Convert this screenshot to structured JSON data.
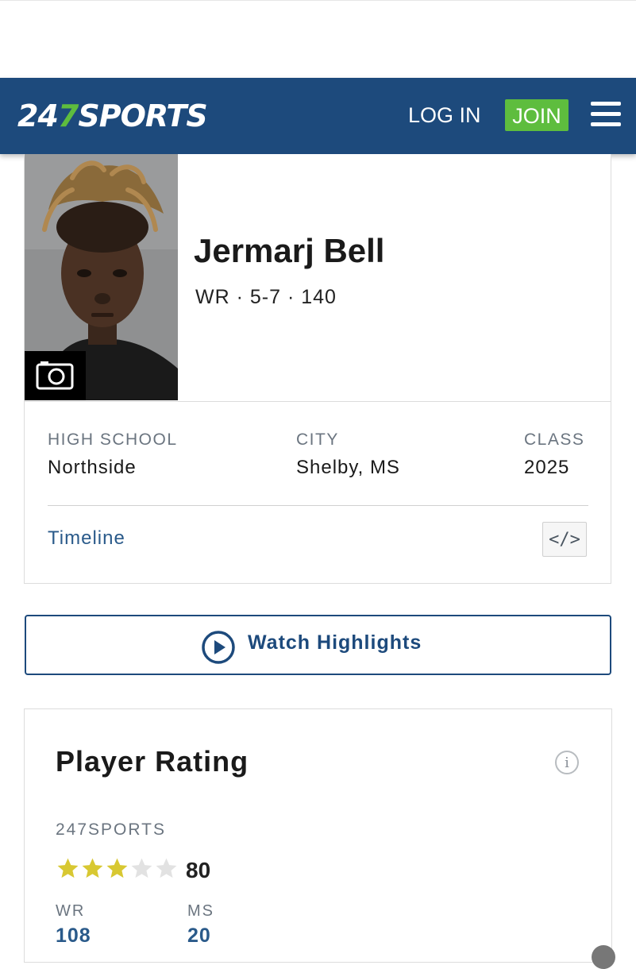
{
  "header": {
    "logo_prefix": "24",
    "logo_seven": "7",
    "logo_suffix": "SPORTS",
    "login_label": "LOG IN",
    "join_label": "JOIN",
    "menu_icon": "hamburger-menu-icon"
  },
  "player": {
    "name": "Jermarj Bell",
    "meta": "WR · 5-7 · 140",
    "photo_icon": "camera-icon"
  },
  "info": {
    "high_school_label": "HIGH SCHOOL",
    "high_school_value": "Northside",
    "city_label": "CITY",
    "city_value": "Shelby, MS",
    "class_label": "CLASS",
    "class_value": "2025",
    "timeline_label": "Timeline",
    "embed_icon": "</>"
  },
  "highlights": {
    "label": "Watch Highlights",
    "icon": "play-circle-icon"
  },
  "rating": {
    "title": "Player Rating",
    "info_icon": "i",
    "source": "247SPORTS",
    "stars_filled": 3,
    "stars_total": 5,
    "score": "80",
    "position_label": "WR",
    "position_rank": "108",
    "state_label": "MS",
    "state_rank": "20"
  },
  "colors": {
    "brand_blue": "#1d4a7c",
    "brand_green": "#5ebd3e",
    "star_gold": "#d8c832",
    "star_empty": "#e2e2e2",
    "link_blue": "#2a5a8a"
  }
}
